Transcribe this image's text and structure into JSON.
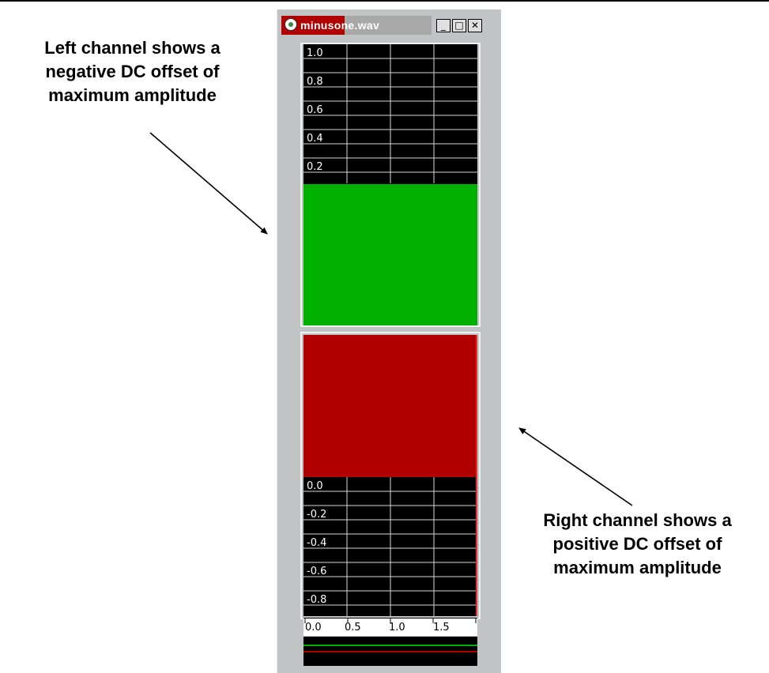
{
  "annotations": {
    "left": "Left channel shows a\nnegative DC offset of\nmaximum amplitude",
    "right": "Right channel shows a\npositive DC offset of\nmaximum amplitude"
  },
  "window": {
    "title": "minusone.wav",
    "controls": {
      "minimize": "_",
      "maximize": "□",
      "close": "✕"
    },
    "icon": "cd-audio-icon"
  },
  "left_channel": {
    "y_ticks": [
      "1.0",
      "0.8",
      "0.6",
      "0.4",
      "0.2"
    ],
    "fill_color": "#00b000",
    "dc_offset": -1.0
  },
  "right_channel": {
    "y_ticks": [
      "0.0",
      "-0.2",
      "-0.4",
      "-0.6",
      "-0.8"
    ],
    "fill_color": "#b00000",
    "dc_offset": 1.0
  },
  "time_axis": {
    "ticks": [
      "0.0",
      "0.5",
      "1.0",
      "1.5"
    ]
  },
  "overview": {
    "colors": [
      "#00b000",
      "#b00000"
    ]
  }
}
